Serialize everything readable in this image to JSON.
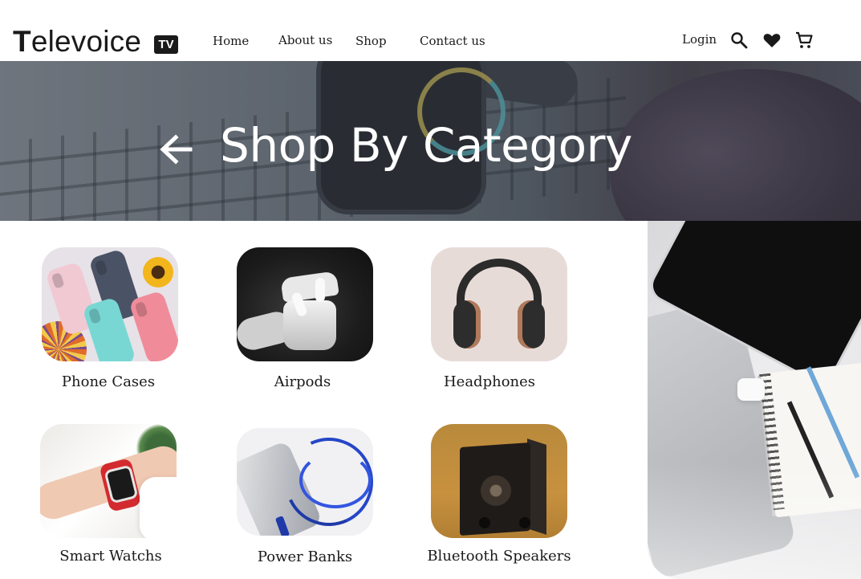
{
  "header": {
    "logo": {
      "wordmark_first": "T",
      "wordmark_rest": "elevoice",
      "badge": "TV"
    },
    "nav": {
      "home": "Home",
      "about": "About us",
      "shop": "Shop",
      "contact": "Contact us"
    },
    "login": "Login",
    "icons": [
      "search-icon",
      "heart-icon",
      "cart-icon"
    ]
  },
  "hero": {
    "title": "Shop By Category",
    "back_icon": "arrow-left-icon"
  },
  "categories": [
    {
      "label": "Phone Cases"
    },
    {
      "label": "Airpods"
    },
    {
      "label": "Headphones"
    },
    {
      "label": "Smart Watchs"
    },
    {
      "label": "Power Banks"
    },
    {
      "label": "Bluetooth Speakers"
    }
  ],
  "colors": {
    "text": "#1a1a1a",
    "hero_text": "#ffffff",
    "background": "#ffffff"
  }
}
